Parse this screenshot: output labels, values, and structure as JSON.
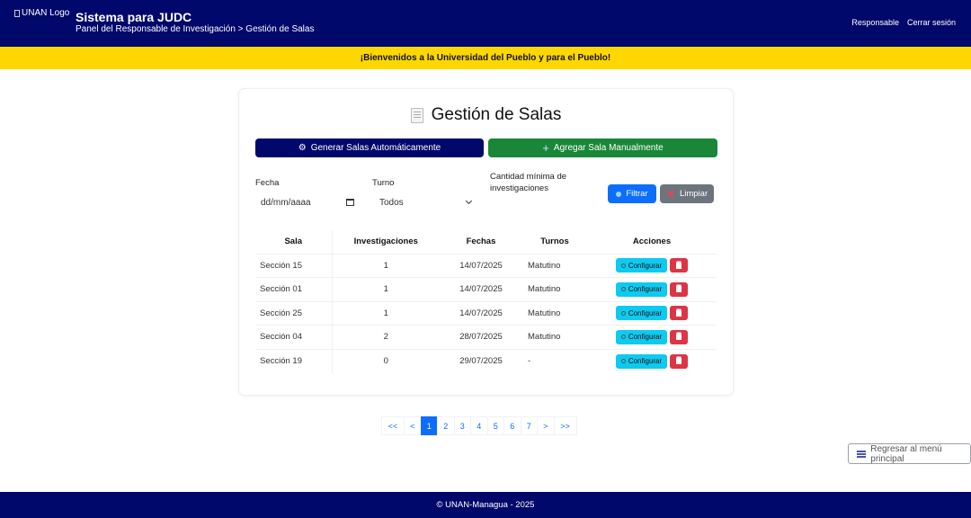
{
  "header": {
    "logo_alt": "UNAN Logo",
    "title": "Sistema para JUDC",
    "breadcrumb": "Panel del Responsable de Investigación > Gestión de Salas",
    "role_link": "Responsable",
    "logout_link": "Cerrar sesión",
    "background": "#00086b"
  },
  "banner": {
    "text": "¡Bienvenidos a la Universidad del Pueblo y para el Pueblo!",
    "background": "#ffd700"
  },
  "page": {
    "title": "Gestión de Salas",
    "title_icon": "ledger-icon",
    "btn_auto": "Generar Salas Automáticamente",
    "btn_auto_icon": "gear-icon",
    "btn_manual": "Agregar Sala Manualmente",
    "btn_manual_icon": "plus-icon"
  },
  "filters": {
    "fecha_label": "Fecha",
    "fecha_placeholder": "dd/mm/aaaa",
    "turno_label": "Turno",
    "turno_value": "Todos",
    "cantidad_label": "Cantidad mínima de investigaciones",
    "filtrar_label": "Filtrar",
    "limpiar_label": "Limpiar"
  },
  "table": {
    "headers": {
      "sala": "Sala",
      "investigaciones": "Investigaciones",
      "fechas": "Fechas",
      "turnos": "Turnos",
      "acciones": "Acciones"
    },
    "config_label": "Configurar",
    "rows": [
      {
        "sala": "Sección 15",
        "investigaciones": "1",
        "fechas": "14/07/2025",
        "turnos": "Matutino"
      },
      {
        "sala": "Sección 01",
        "investigaciones": "1",
        "fechas": "14/07/2025",
        "turnos": "Matutino"
      },
      {
        "sala": "Sección 25",
        "investigaciones": "1",
        "fechas": "14/07/2025",
        "turnos": "Matutino"
      },
      {
        "sala": "Sección 04",
        "investigaciones": "2",
        "fechas": "28/07/2025",
        "turnos": "Matutino"
      },
      {
        "sala": "Sección 19",
        "investigaciones": "0",
        "fechas": "29/07/2025",
        "turnos": "-"
      }
    ]
  },
  "pagination": {
    "first": "<<",
    "prev": "<",
    "pages": [
      "1",
      "2",
      "3",
      "4",
      "5",
      "6",
      "7"
    ],
    "current": "1",
    "next": ">",
    "last": ">>"
  },
  "back_button": "Regresar al menú principal",
  "footer": {
    "text": "© UNAN-Managua - 2025"
  },
  "colors": {
    "primary_navy": "#00086b",
    "success": "#198737",
    "info": "#0dcaf0",
    "danger": "#dc3545",
    "link": "#0d6efd",
    "secondary": "#6c757d"
  }
}
